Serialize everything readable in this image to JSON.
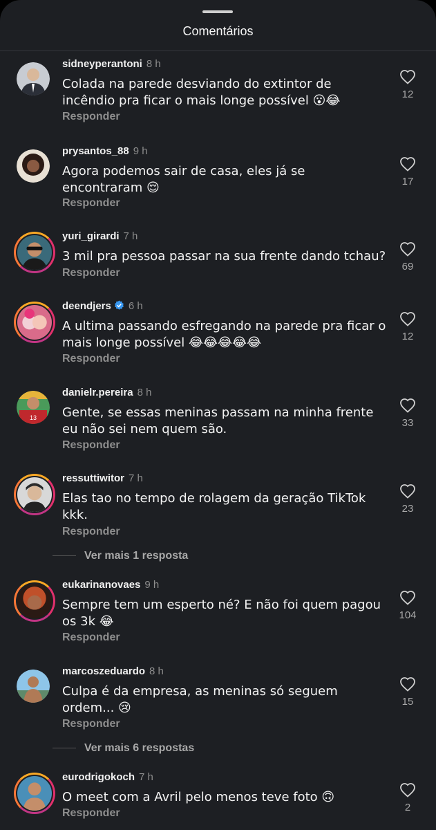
{
  "header": {
    "title": "Comentários"
  },
  "comments": [
    {
      "username": "sidneyperantoni",
      "time": "8 h",
      "text": "Colada na parede desviando do extintor de incêndio pra ficar o mais longe possível 😮😂",
      "likes": "12",
      "reply": "Responder",
      "avatar_color": "#c8ccd2"
    },
    {
      "username": "prysantos_88",
      "time": "9 h",
      "text": "Agora podemos sair de casa, eles já se encontraram 😌",
      "likes": "17",
      "reply": "Responder",
      "avatar_color": "#6b4a3a"
    },
    {
      "username": "yuri_girardi",
      "time": "7 h",
      "text": "3 mil pra pessoa passar na sua frente dando tchau?",
      "likes": "69",
      "reply": "Responder",
      "avatar_color": "#3a6a7a"
    },
    {
      "username": "deendjers",
      "time": "6 h",
      "verified": true,
      "text": "A ultima passando esfregando na parede pra ficar o mais longe possível 😂😂😂😂😂",
      "likes": "12",
      "reply": "Responder",
      "avatar_color": "#d96b8a"
    },
    {
      "username": "danielr.pereira",
      "time": "8 h",
      "text": "Gente, se essas meninas passam na minha frente eu não sei nem quem são.",
      "likes": "33",
      "reply": "Responder",
      "avatar_color": "#c0282d"
    },
    {
      "username": "ressuttiwitor",
      "time": "7 h",
      "text": "Elas tao no tempo de rolagem da geração TikTok kkk.",
      "likes": "23",
      "reply": "Responder",
      "avatar_color": "#9a9a9a",
      "more_replies": "Ver mais 1 resposta"
    },
    {
      "username": "eukarinanovaes",
      "time": "9 h",
      "text": "Sempre tem um esperto né? E não foi quem pagou os 3k 😂",
      "likes": "104",
      "reply": "Responder",
      "avatar_color": "#c0502a"
    },
    {
      "username": "marcoszeduardo",
      "time": "8 h",
      "text": "Culpa é da empresa, as meninas só seguem ordem... 😢",
      "likes": "15",
      "reply": "Responder",
      "avatar_color": "#5f8a6a",
      "more_replies": "Ver mais 6 respostas"
    },
    {
      "username": "eurodrigokoch",
      "time": "7 h",
      "text": "O meet com a Avril pelo menos teve foto 🙃",
      "likes": "2",
      "reply": "Responder",
      "avatar_color": "#4a8fb8"
    }
  ],
  "colors": {
    "background": "#1d1f23",
    "secondary_text": "#8e8e8e",
    "verified": "#3897f0"
  },
  "icons": {
    "like": "heart-outline-icon",
    "verified": "verified-badge-icon"
  }
}
